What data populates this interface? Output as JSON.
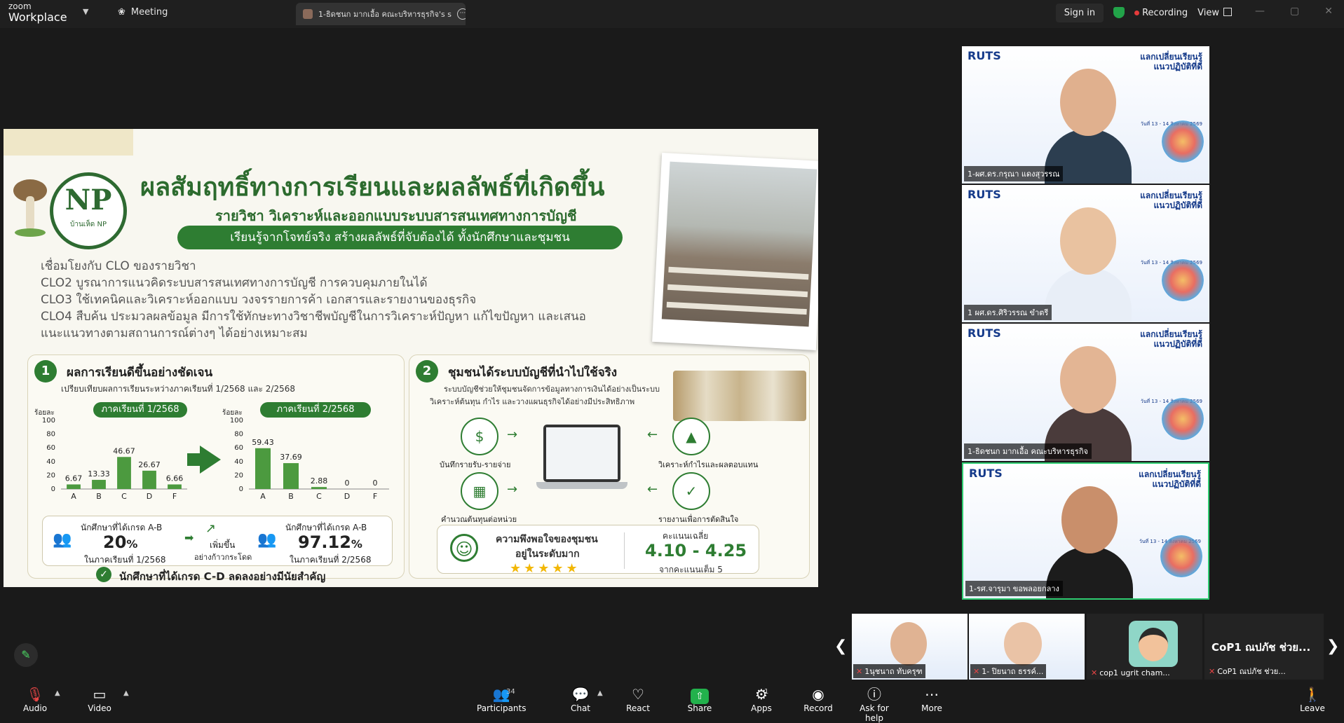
{
  "app": {
    "brand_top": "zoom",
    "brand_bottom": "Workplace",
    "meeting_tab": "Meeting",
    "doc_tab": "1-ธิดชนก มากเอื้อ คณะบริหารธุรกิจ's s",
    "sign_in": "Sign in",
    "recording": "Recording",
    "view": "View"
  },
  "slide": {
    "title": "ผลสัมฤทธิ์ทางการเรียนและผลลัพธ์ที่เกิดขึ้น",
    "subtitle": "รายวิชา วิเคราะห์และออกแบบระบบสารสนเทศทางการบัญชี",
    "pill": "เรียนรู้จากโจทย์จริง สร้างผลลัพธ์ที่จับต้องได้ ทั้งนักศึกษาและชุมชน",
    "logo_text": "NP",
    "logo_sub": "บ้านเห็ด NP",
    "clo_lines": [
      "เชื่อมโยงกับ CLO ของรายวิชา",
      "CLO2 บูรณาการแนวคิดระบบสารสนเทศทางการบัญชี การควบคุมภายในได้",
      "CLO3 ใช้เทคนิคและวิเคราะห์ออกแบบ วงจรรายการค้า เอกสารและรายงานของธุรกิจ",
      "CLO4 สืบค้น ประมวลผลข้อมูล มีการใช้ทักษะทางวิชาชีพบัญชีในการวิเคราะห์ปัญหา แก้ไขปัญหา และเสนอ",
      "แนะแนวทางตามสถานการณ์ต่างๆ ได้อย่างเหมาะสม"
    ],
    "panel1": {
      "num": "1",
      "title": "ผลการเรียนดีขึ้นอย่างชัดเจน",
      "sub": "เปรียบเทียบผลการเรียนระหว่างภาคเรียนที่ 1/2568 และ 2/2568",
      "stat1_label": "นักศึกษาที่ได้เกรด A-B",
      "stat1_value": "20",
      "stat1_unit": "%",
      "stat1_term": "ในภาคเรียนที่ 1/2568",
      "increase_label": "เพิ่มขึ้น",
      "increase_sub": "อย่างก้าวกระโดด",
      "stat2_label": "นักศึกษาที่ได้เกรด A-B",
      "stat2_value": "97.12",
      "stat2_unit": "%",
      "stat2_term": "ในภาคเรียนที่ 2/2568",
      "check_text": "นักศึกษาที่ได้เกรด C-D ลดลงอย่างมีนัยสำคัญ",
      "check_mark": "✓"
    },
    "panel2": {
      "num": "2",
      "title": "ชุมชนได้ระบบบัญชีที่นำไปใช้จริง",
      "sub1": "ระบบบัญชีช่วยให้ชุมชนจัดการข้อมูลทางการเงินได้อย่างเป็นระบบ",
      "sub2": "วิเคราะห์ต้นทุน กำไร และวางแผนธุรกิจได้อย่างมีประสิทธิภาพ",
      "icons": [
        {
          "label": "บันทึกรายรับ-รายจ่าย",
          "icon": "receipt-icon",
          "glyph": "$"
        },
        {
          "label": "คำนวณต้นทุนต่อหน่วย",
          "icon": "calculator-icon",
          "glyph": "▦"
        },
        {
          "label": "วิเคราะห์กำไรและผลตอบแทน",
          "icon": "bar-chart-icon",
          "glyph": "▲"
        },
        {
          "label": "รายงานเพื่อการตัดสินใจ",
          "icon": "report-icon",
          "glyph": "✓"
        }
      ],
      "sat_title": "ความพึงพอใจของชุมชน",
      "sat_level": "อยู่ในระดับมาก",
      "stars": "★★★★★",
      "score_label": "คะแนนเฉลี่ย",
      "score_value": "4.10 - 4.25",
      "score_sub": "จากคะแนนเต็ม 5"
    }
  },
  "chart_data": [
    {
      "type": "bar",
      "title": "ภาคเรียนที่ 1/2568",
      "ylabel": "ร้อยละ",
      "categories": [
        "A",
        "B",
        "C",
        "D",
        "F"
      ],
      "values": [
        6.67,
        13.33,
        46.67,
        26.67,
        6.66
      ],
      "ylim": [
        0,
        100
      ],
      "yticks": [
        0,
        20,
        40,
        60,
        80,
        100
      ],
      "color": "#4c9a3f"
    },
    {
      "type": "bar",
      "title": "ภาคเรียนที่ 2/2568",
      "ylabel": "ร้อยละ",
      "categories": [
        "A",
        "B",
        "C",
        "D",
        "F"
      ],
      "values": [
        59.43,
        37.69,
        2.88,
        0,
        0
      ],
      "ylim": [
        0,
        100
      ],
      "yticks": [
        0,
        20,
        40,
        60,
        80,
        100
      ],
      "color": "#4c9a3f"
    }
  ],
  "videos": [
    {
      "name": "1-ผศ.ดร.กรุณา แดงสุวรรณ",
      "logo": "RUTS",
      "event": "แลกเปลี่ยนเรียนรู้\nแนวปฏิบัติที่ดี",
      "dates": "วันที่ 13 - 14 สิงหาคม 2569",
      "skin": "#e0b08e",
      "shirt": "#2c3e50"
    },
    {
      "name": "1 ผศ.ดร.ศิริวรรณ ขำตรี",
      "logo": "RUTS",
      "event": "แลกเปลี่ยนเรียนรู้\nแนวปฏิบัติที่ดี",
      "dates": "วันที่ 13 - 14 สิงหาคม 2569",
      "skin": "#e9c2a0",
      "shirt": "#e8eef7"
    },
    {
      "name": "1-ธิดชนก มากเอื้อ คณะบริหารธุรกิจ",
      "logo": "RUTS",
      "event": "แลกเปลี่ยนเรียนรู้\nแนวปฏิบัติที่ดี",
      "dates": "วันที่ 13 - 14 สิงหาคม 2569",
      "skin": "#e3b594",
      "shirt": "#4a3b3b"
    },
    {
      "name": "1-รศ.จารุมา ขอพลอยกลาง",
      "logo": "RUTS",
      "event": "แลกเปลี่ยนเรียนรู้\nแนวปฏิบัติที่ดี",
      "dates": "วันที่ 13 - 14 สิงหาคม 2569",
      "skin": "#c98f6b",
      "shirt": "#1c1c1c"
    }
  ],
  "strip": [
    {
      "name": "1นุชนาถ ทับครุฑ"
    },
    {
      "name": "1- ปิยนาถ ธรรค์..."
    },
    {
      "name": "cop1 ugrit cham..."
    },
    {
      "name": "CoP1 ณปภัช ช่วย...",
      "big": "CoP1 ณปภัช ช่วย..."
    }
  ],
  "toolbar": {
    "audio": "Audio",
    "video": "Video",
    "participants": "Participants",
    "participants_count": "34",
    "chat": "Chat",
    "react": "React",
    "share": "Share",
    "apps": "Apps",
    "apps_count": "1",
    "record": "Record",
    "help": "Ask for help",
    "more": "More",
    "leave": "Leave"
  },
  "colors": {
    "accent_green": "#2e7d32",
    "bar_green": "#4c9a3f",
    "active_speaker": "#2ecc71",
    "recording_red": "#e63b3b"
  }
}
